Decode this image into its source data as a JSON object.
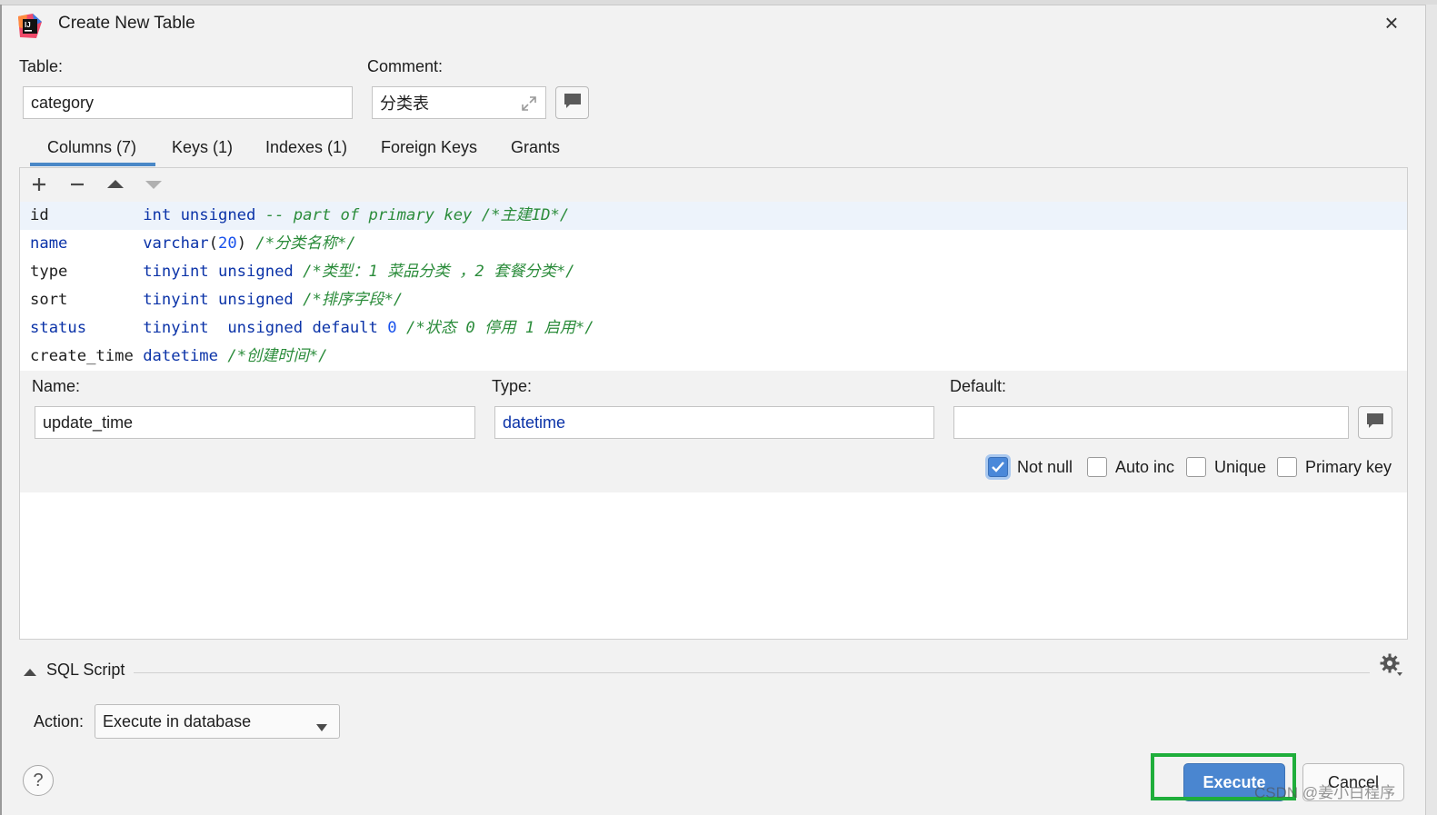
{
  "window": {
    "title": "Create New Table",
    "close_glyph": "×"
  },
  "table": {
    "label": "Table:",
    "value": "category"
  },
  "comment": {
    "label": "Comment:",
    "value": "分类表"
  },
  "tabs": [
    {
      "label": "Columns (7)",
      "active": true
    },
    {
      "label": "Keys (1)"
    },
    {
      "label": "Indexes (1)"
    },
    {
      "label": "Foreign Keys"
    },
    {
      "label": "Grants"
    }
  ],
  "toolbar": {
    "add": "+",
    "remove": "−"
  },
  "columns": [
    {
      "name": "id",
      "type": "int unsigned",
      "note": "-- part of primary key",
      "comment": "/*主建ID*/"
    },
    {
      "name": "name",
      "type_kw": "varchar",
      "type_arg": "20",
      "comment": "/*分类名称*/"
    },
    {
      "name": "type",
      "type": "tinyint unsigned",
      "comment": "/*类型：1 菜品分类 ，2 套餐分类*/"
    },
    {
      "name": "sort",
      "type": "tinyint unsigned",
      "comment": "/*排序字段*/"
    },
    {
      "name": "status",
      "type": "tinyint  unsigned default",
      "default": "0",
      "comment": "/*状态 0 停用 1 启用*/"
    },
    {
      "name": "create_time",
      "type": "datetime",
      "comment": "/*创建时间*/"
    }
  ],
  "editor": {
    "name_label": "Name:",
    "name_value": "update_time",
    "type_label": "Type:",
    "type_value": "datetime",
    "default_label": "Default:",
    "default_value": "",
    "checkboxes": [
      {
        "label": "Not null",
        "checked": true
      },
      {
        "label": "Auto inc",
        "checked": false
      },
      {
        "label": "Unique",
        "checked": false
      },
      {
        "label": "Primary key",
        "checked": false
      }
    ]
  },
  "sql_script": {
    "label": "SQL Script"
  },
  "action": {
    "label": "Action:",
    "value": "Execute in database"
  },
  "buttons": {
    "execute": "Execute",
    "cancel": "Cancel",
    "help": "?"
  },
  "watermark": "CSDN @姜小白程序",
  "colors": {
    "accent": "#4a86d0",
    "highlight": "#1fae3b",
    "keyword": "#0b33a8",
    "comment": "#2b8c3b"
  }
}
